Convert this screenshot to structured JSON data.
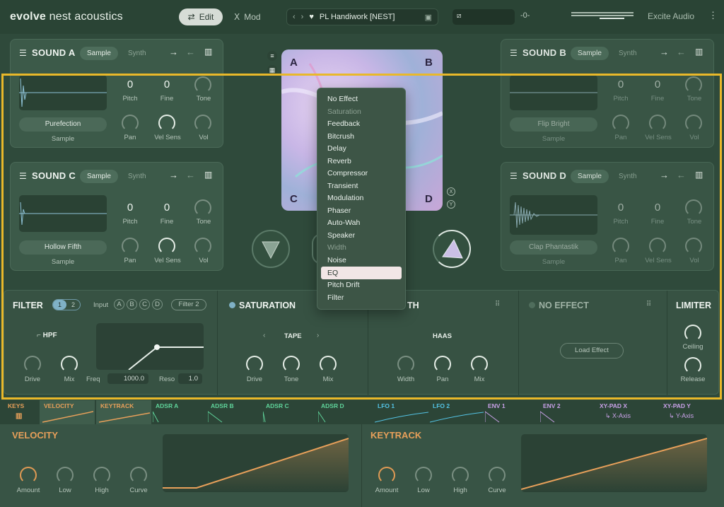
{
  "topbar": {
    "brand_bold": "evolve",
    "brand_rest": " nest acoustics",
    "edit_label": "Edit",
    "mod_label": "Mod",
    "preset_name": "PL Handiwork [NEST]",
    "vendor": "Excite Audio"
  },
  "sounds": {
    "a": {
      "title": "SOUND A",
      "tab_sample": "Sample",
      "tab_synth": "Synth",
      "pitch": "0",
      "fine": "0",
      "name": "Purefection",
      "source": "Sample"
    },
    "b": {
      "title": "SOUND B",
      "tab_sample": "Sample",
      "tab_synth": "Synth",
      "pitch": "0",
      "fine": "0",
      "name": "Flip Bright",
      "source": "Sample"
    },
    "c": {
      "title": "SOUND C",
      "tab_sample": "Sample",
      "tab_synth": "Synth",
      "pitch": "0",
      "fine": "0",
      "name": "Hollow Fifth",
      "source": "Sample"
    },
    "d": {
      "title": "SOUND D",
      "tab_sample": "Sample",
      "tab_synth": "Synth",
      "pitch": "0",
      "fine": "0",
      "name": "Clap Phantastik",
      "source": "Sample"
    }
  },
  "sound_labels": {
    "pitch": "Pitch",
    "fine": "Fine",
    "tone": "Tone",
    "pan": "Pan",
    "vel_sens": "Vel Sens",
    "vol": "Vol"
  },
  "xypad": {
    "a": "A",
    "b": "B",
    "c": "C",
    "d": "D",
    "x": "X",
    "y": "Y"
  },
  "dropdown": {
    "items": [
      "No Effect",
      "Saturation",
      "Feedback",
      "Bitcrush",
      "Delay",
      "Reverb",
      "Compressor",
      "Transient",
      "Modulation",
      "Phaser",
      "Auto-Wah",
      "Speaker",
      "Width",
      "Noise",
      "EQ",
      "Pitch Drift",
      "Filter"
    ],
    "disabled": [
      "Saturation",
      "Width"
    ],
    "selected": "EQ"
  },
  "filter": {
    "title": "FILTER",
    "tab1": "1",
    "tab2": "2",
    "input_label": "Input",
    "inputs": [
      "A",
      "B",
      "C",
      "D"
    ],
    "input_sel": "Filter 2",
    "type": "HPF",
    "drive": "Drive",
    "mix": "Mix",
    "freq_label": "Freq",
    "freq_value": "1000.0",
    "reso_label": "Reso",
    "reso_value": "1.0"
  },
  "saturation": {
    "title": "SATURATION",
    "mode": "TAPE",
    "drive": "Drive",
    "tone": "Tone",
    "mix": "Mix"
  },
  "width_fx": {
    "title": "TH",
    "mode": "HAAS",
    "width": "Width",
    "pan": "Pan",
    "mix": "Mix"
  },
  "noeffect": {
    "title": "NO EFFECT",
    "load": "Load Effect"
  },
  "limiter": {
    "title": "LIMITER",
    "ceiling": "Ceiling",
    "release": "Release"
  },
  "modtabs": [
    {
      "label": "KEYS",
      "color": "#e8a05a"
    },
    {
      "label": "VELOCITY",
      "color": "#e8a05a"
    },
    {
      "label": "KEYTRACK",
      "color": "#e8a05a"
    },
    {
      "label": "ADSR A",
      "color": "#5fd39a"
    },
    {
      "label": "ADSR B",
      "color": "#5fd39a"
    },
    {
      "label": "ADSR C",
      "color": "#5fd39a"
    },
    {
      "label": "ADSR D",
      "color": "#5fd39a"
    },
    {
      "label": "LFO 1",
      "color": "#54c4e6"
    },
    {
      "label": "LFO 2",
      "color": "#54c4e6"
    },
    {
      "label": "ENV 1",
      "color": "#c9a1e8"
    },
    {
      "label": "ENV 2",
      "color": "#c9a1e8"
    },
    {
      "label": "XY-PAD X",
      "color": "#c9a1e8"
    },
    {
      "label": "XY-PAD Y",
      "color": "#c9a1e8"
    }
  ],
  "xaxis": "X-Axis",
  "yaxis": "Y-Axis",
  "velocity": {
    "title": "VELOCITY",
    "amount": "Amount",
    "low": "Low",
    "high": "High",
    "curve": "Curve"
  },
  "keytrack": {
    "title": "KEYTRACK",
    "amount": "Amount",
    "low": "Low",
    "high": "High",
    "curve": "Curve"
  }
}
